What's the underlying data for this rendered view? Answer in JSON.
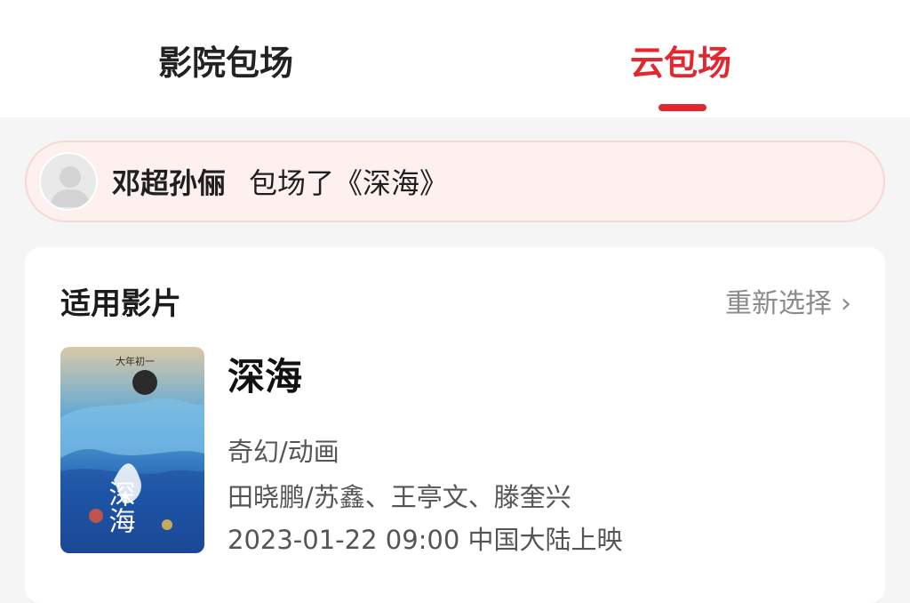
{
  "tabs": [
    {
      "label": "影院包场",
      "active": false
    },
    {
      "label": "云包场",
      "active": true
    }
  ],
  "colors": {
    "accent": "#e0282e",
    "notice_bg": "#fdf0ee"
  },
  "notice": {
    "user": "邓超孙俪",
    "action": "包场了《深海》",
    "avatar_icon": "user-avatar-placeholder"
  },
  "section": {
    "title": "适用影片",
    "reselect_label": "重新选择",
    "reselect_icon": "chevron-right-icon"
  },
  "movie": {
    "title": "深海",
    "genre": "奇幻/动画",
    "crew": "田晓鹏/苏鑫、王亭文、滕奎兴",
    "release": "2023-01-22 09:00 中国大陆上映",
    "poster": {
      "tagline": "大年初一",
      "calligraphy": "深海"
    }
  }
}
